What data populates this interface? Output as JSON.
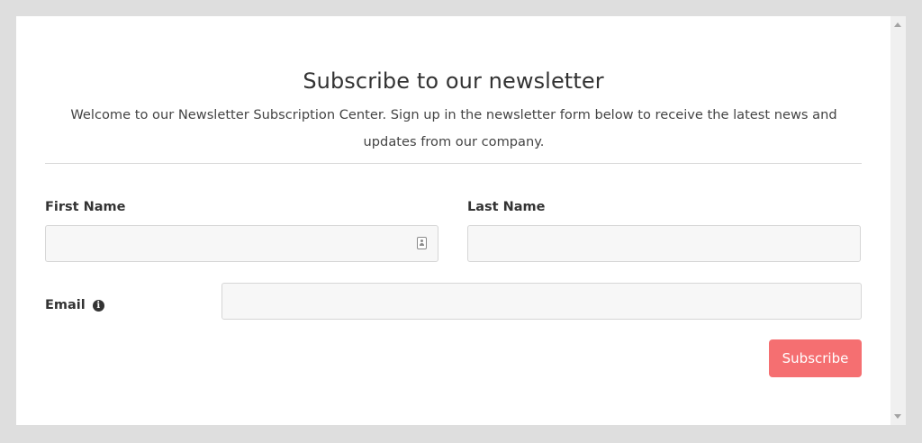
{
  "form": {
    "title": "Subscribe to our newsletter",
    "description": "Welcome to our Newsletter Subscription Center. Sign up in the newsletter form below to receive the latest news and updates from our company.",
    "first_name": {
      "label": "First Name",
      "value": "",
      "placeholder": ""
    },
    "last_name": {
      "label": "Last Name",
      "value": "",
      "placeholder": ""
    },
    "email": {
      "label": "Email",
      "value": "",
      "placeholder": "",
      "info_icon": "info-circle-icon"
    },
    "subscribe_label": "Subscribe"
  },
  "colors": {
    "accent": "#f56f71",
    "page_background": "#dedede",
    "input_background": "#f7f7f7"
  },
  "icons": {
    "autofill": "contact-card-icon",
    "info": "info-circle-icon",
    "scroll_up": "scroll-up-arrow-icon",
    "scroll_down": "scroll-down-arrow-icon"
  }
}
